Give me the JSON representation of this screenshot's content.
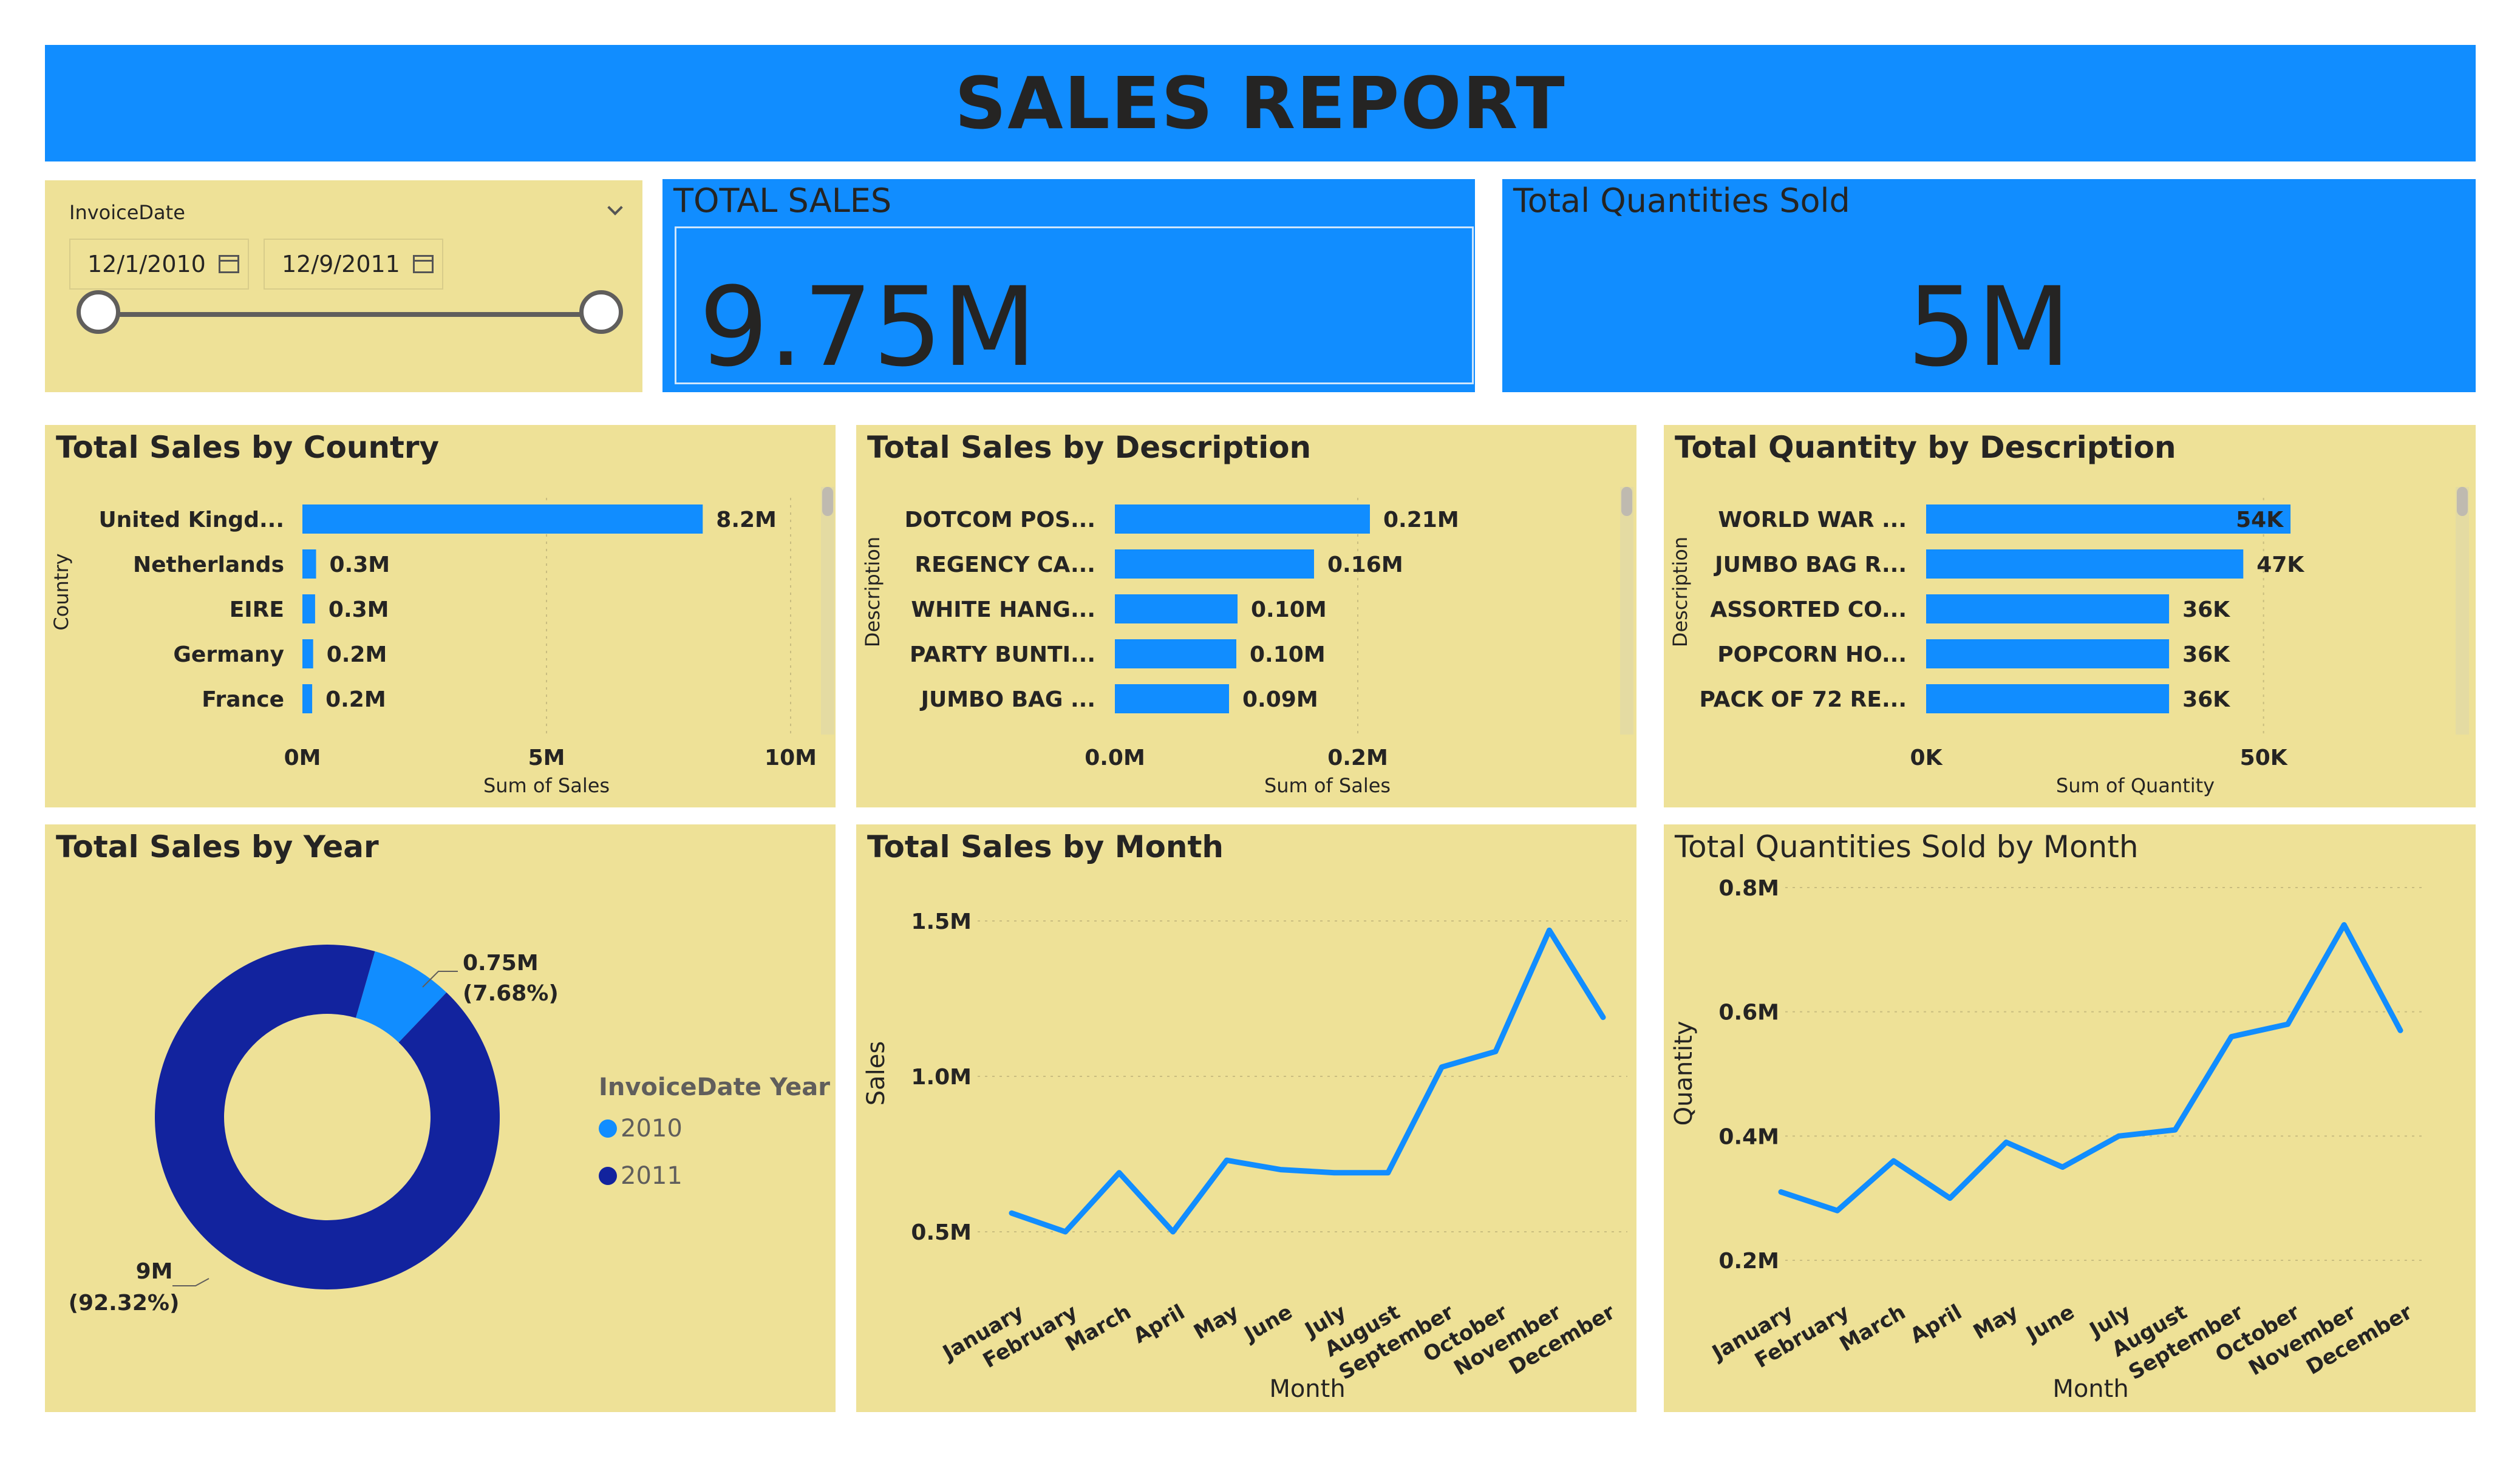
{
  "report": {
    "title": "SALES REPORT"
  },
  "slicer": {
    "label": "InvoiceDate",
    "start_date": "12/1/2010",
    "end_date": "12/9/2011"
  },
  "kpis": {
    "total_sales": {
      "title": "TOTAL SALES",
      "value": "9.75M"
    },
    "total_quantity": {
      "title": "Total Quantities Sold",
      "value": "5M"
    }
  },
  "colors": {
    "banner": "#118dff",
    "panel": "#eee197",
    "bar": "#118dff",
    "series_2010": "#118dff",
    "series_2011": "#12239e"
  },
  "chart_data": [
    {
      "id": "sales_by_country",
      "type": "bar",
      "orientation": "horizontal",
      "title": "Total Sales by Country",
      "xlabel": "Sum of Sales",
      "ylabel": "Country",
      "categories": [
        "United Kingd...",
        "Netherlands",
        "EIRE",
        "Germany",
        "France"
      ],
      "values": [
        8.2,
        0.28,
        0.26,
        0.22,
        0.2
      ],
      "data_labels": [
        "8.2M",
        "0.3M",
        "0.3M",
        "0.2M",
        "0.2M"
      ],
      "xlim": [
        0,
        10
      ],
      "ticks": [
        0,
        5,
        10
      ],
      "tick_labels": [
        "0M",
        "5M",
        "10M"
      ]
    },
    {
      "id": "sales_by_description",
      "type": "bar",
      "orientation": "horizontal",
      "title": "Total Sales by Description",
      "xlabel": "Sum of Sales",
      "ylabel": "Description",
      "categories": [
        "DOTCOM POS...",
        "REGENCY CA...",
        "WHITE HANG...",
        "PARTY BUNTI...",
        "JUMBO BAG ..."
      ],
      "values": [
        0.21,
        0.164,
        0.101,
        0.1,
        0.094
      ],
      "data_labels": [
        "0.21M",
        "0.16M",
        "0.10M",
        "0.10M",
        "0.09M"
      ],
      "xlim": [
        0,
        0.35
      ],
      "ticks": [
        0,
        0.2
      ],
      "tick_labels": [
        "0.0M",
        "0.2M"
      ]
    },
    {
      "id": "quantity_by_description",
      "type": "bar",
      "orientation": "horizontal",
      "title": "Total Quantity by Description",
      "xlabel": "Sum of Quantity",
      "ylabel": "Description",
      "categories": [
        "WORLD WAR ...",
        "JUMBO BAG R...",
        "ASSORTED CO...",
        "POPCORN HO...",
        "PACK OF 72 RE..."
      ],
      "values": [
        54,
        47,
        36,
        36,
        36
      ],
      "data_labels": [
        "54K",
        "47K",
        "36K",
        "36K",
        "36K"
      ],
      "xlim": [
        0,
        62
      ],
      "ticks": [
        0,
        50
      ],
      "tick_labels": [
        "0K",
        "50K"
      ]
    },
    {
      "id": "sales_by_year",
      "type": "pie",
      "style": "donut",
      "title": "Total Sales by Year",
      "legend_title": "InvoiceDate Year",
      "legend_position": "right",
      "labels": [
        "2010",
        "2011"
      ],
      "values": [
        0.75,
        9.0
      ],
      "percents": [
        7.68,
        92.32
      ],
      "data_labels": [
        [
          "0.75M",
          "(7.68%)"
        ],
        [
          "9M",
          "(92.32%)"
        ]
      ]
    },
    {
      "id": "sales_by_month",
      "type": "line",
      "title": "Total Sales by Month",
      "xlabel": "Month",
      "ylabel": "Sales",
      "categories": [
        "January",
        "February",
        "March",
        "April",
        "May",
        "June",
        "July",
        "August",
        "September",
        "October",
        "November",
        "December"
      ],
      "values": [
        0.56,
        0.5,
        0.69,
        0.5,
        0.73,
        0.7,
        0.69,
        0.69,
        1.03,
        1.08,
        1.47,
        1.19
      ],
      "ylim": [
        0.4,
        1.6
      ],
      "ticks": [
        0.5,
        1.0,
        1.5
      ],
      "tick_labels": [
        "0.5M",
        "1.0M",
        "1.5M"
      ],
      "grid": true
    },
    {
      "id": "quantity_by_month",
      "type": "line",
      "title": "Total Quantities Sold by Month",
      "xlabel": "Month",
      "ylabel": "Quantity",
      "categories": [
        "January",
        "February",
        "March",
        "April",
        "May",
        "June",
        "July",
        "August",
        "September",
        "October",
        "November",
        "December"
      ],
      "values": [
        0.31,
        0.28,
        0.36,
        0.3,
        0.39,
        0.35,
        0.4,
        0.41,
        0.56,
        0.58,
        0.74,
        0.57
      ],
      "ylim": [
        0.2,
        0.8
      ],
      "ticks": [
        0.2,
        0.4,
        0.6,
        0.8
      ],
      "tick_labels": [
        "0.2M",
        "0.4M",
        "0.6M",
        "0.8M"
      ],
      "grid": true
    }
  ]
}
